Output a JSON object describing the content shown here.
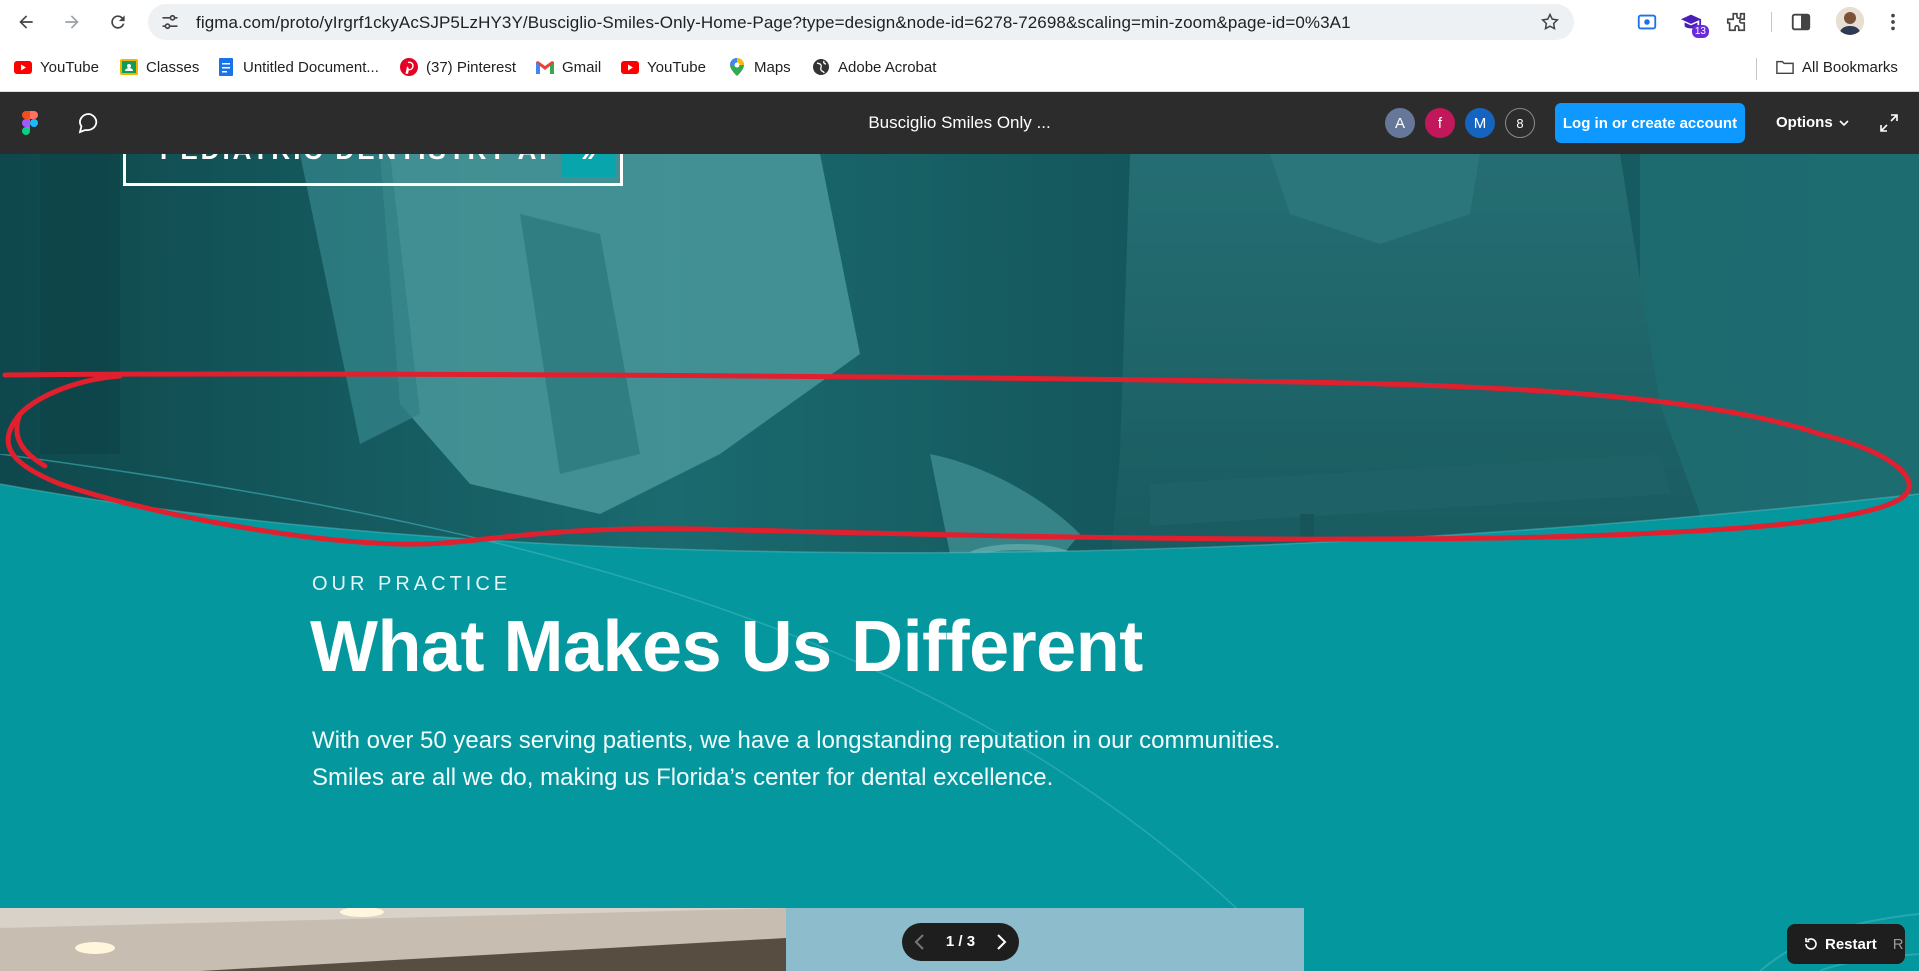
{
  "browser": {
    "url": "figma.com/proto/yIrgrf1ckyAcSJP5LzHY3Y/Busciglio-Smiles-Only-Home-Page?type=design&node-id=6278-72698&scaling=min-zoom&page-id=0%3A1",
    "extension_badge": "13"
  },
  "bookmarks": [
    {
      "label": "YouTube",
      "icon": "youtube-icon"
    },
    {
      "label": "Classes",
      "icon": "classroom-icon"
    },
    {
      "label": "Untitled Document...",
      "icon": "document-icon"
    },
    {
      "label": "(37) Pinterest",
      "icon": "pinterest-icon"
    },
    {
      "label": "Gmail",
      "icon": "gmail-icon"
    },
    {
      "label": "YouTube",
      "icon": "youtube-icon"
    },
    {
      "label": "Maps",
      "icon": "maps-icon"
    },
    {
      "label": "Adobe Acrobat",
      "icon": "globe-icon"
    }
  ],
  "all_bookmarks_label": "All Bookmarks",
  "figma": {
    "title": "Busciglio Smiles Only ...",
    "avatars": [
      {
        "label": "A",
        "color": "#667799"
      },
      {
        "label": "f",
        "color": "#c2185b"
      },
      {
        "label": "M",
        "color": "#1565c0"
      }
    ],
    "viewer_count": "8",
    "login_label": "Log in or create account",
    "options_label": "Options"
  },
  "prototype": {
    "cta_label": "PEDIATRIC DENTISTRY APPT",
    "cta_arrow": "»",
    "eyebrow": "OUR PRACTICE",
    "headline": "What Makes Us Different",
    "body": "With over 50 years serving patients, we have a longstanding reputation in our communities. Smiles are all we do, making us Florida’s center for dental excellence.",
    "teal_color": "#05979e"
  },
  "pager": {
    "label": "1 / 3"
  },
  "restart": {
    "label": "Restart",
    "shortcut": "R"
  }
}
